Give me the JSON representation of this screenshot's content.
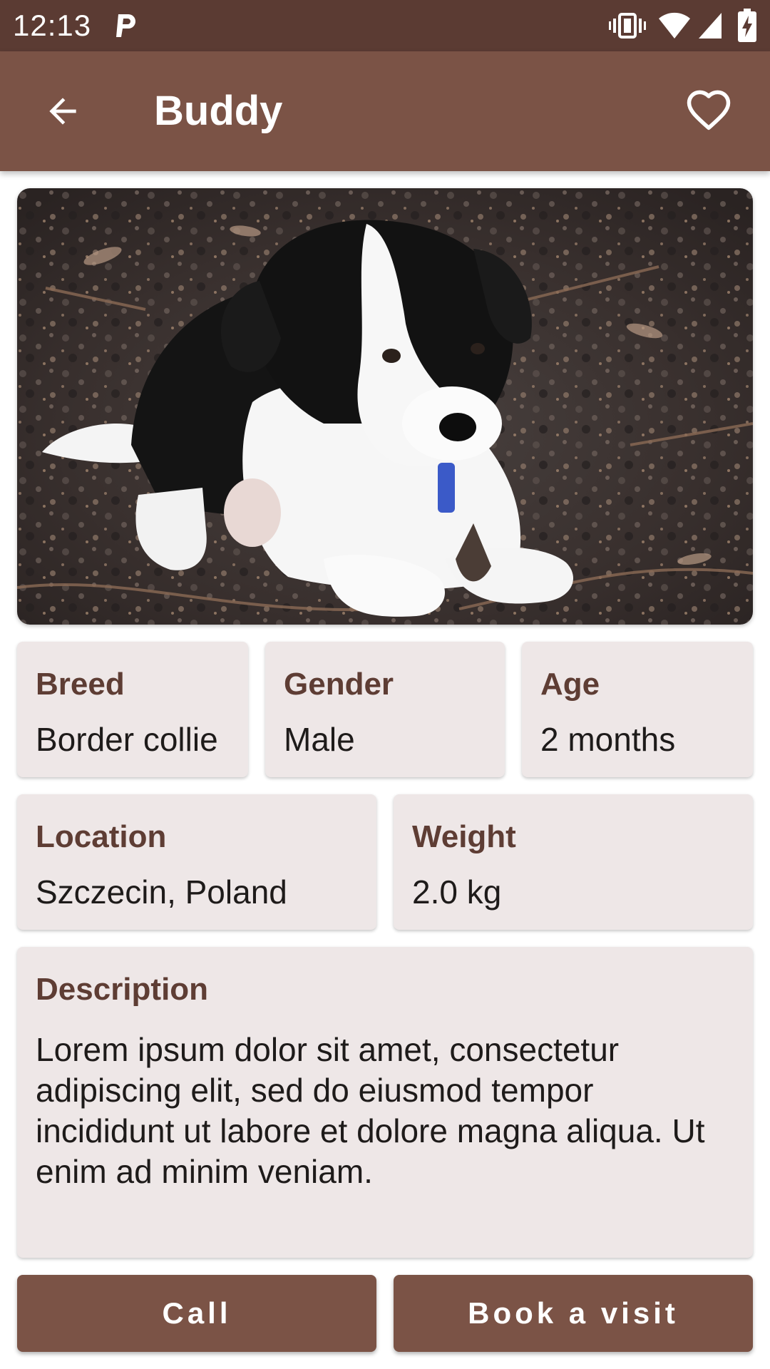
{
  "status_bar": {
    "time": "12:13",
    "icons": [
      "parking-p-icon",
      "vibrate-icon",
      "wifi-icon",
      "signal-icon",
      "battery-charging-icon"
    ]
  },
  "app_bar": {
    "title": "Buddy",
    "back_icon": "arrow-back-icon",
    "favorite_icon": "heart-outline-icon"
  },
  "pet": {
    "photo": "border-collie-puppy-photo",
    "breed": {
      "label": "Breed",
      "value": "Border collie"
    },
    "gender": {
      "label": "Gender",
      "value": "Male"
    },
    "age": {
      "label": "Age",
      "value": "2 months"
    },
    "location": {
      "label": "Location",
      "value": "Szczecin, Poland"
    },
    "weight": {
      "label": "Weight",
      "value": "2.0 kg"
    },
    "description": {
      "label": "Description",
      "value": "Lorem ipsum dolor sit amet, consectetur adipiscing elit, sed do eiusmod tempor incididunt ut labore et dolore magna aliqua. Ut enim ad minim veniam."
    }
  },
  "actions": {
    "call_label": "Call",
    "book_label": "Book a visit"
  },
  "colors": {
    "status_bar": "#5b3b33",
    "primary": "#7b5346",
    "card_background": "#eee7e7",
    "label_text": "#5e3d34"
  }
}
